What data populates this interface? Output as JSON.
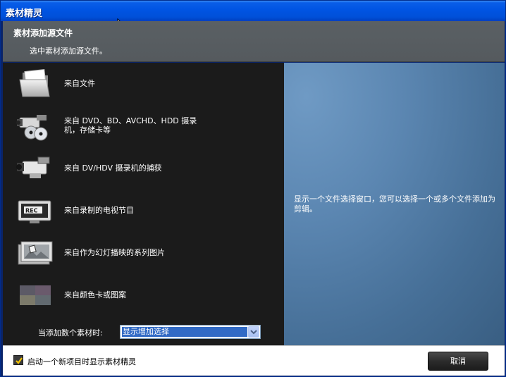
{
  "window": {
    "title": "素材精灵"
  },
  "header": {
    "title": "素材添加源文件",
    "subtitle": "选中素材添加源文件。"
  },
  "options": [
    {
      "icon": "folder-icon",
      "label": "来自文件"
    },
    {
      "icon": "camcorder-disc-icon",
      "label": "来自 DVD、BD、AVCHD、HDD 摄录机，存储卡等"
    },
    {
      "icon": "camcorder-icon",
      "label": "来自 DV/HDV 摄录机的捕获"
    },
    {
      "icon": "tv-rec-icon",
      "label": "来自录制的电视节目"
    },
    {
      "icon": "slideshow-icon",
      "label": "来自作为幻灯播映的系列图片"
    },
    {
      "icon": "color-card-icon",
      "label": "来自颜色卡或图案"
    }
  ],
  "add_multiple": {
    "label": "当添加数个素材时:",
    "selected": "显示增加选择"
  },
  "description": "显示一个文件选择窗口，您可以选择一个或多个文件添加为剪辑。",
  "footer": {
    "checkbox_label": "启动一个新项目时显示素材精灵",
    "checkbox_checked": true,
    "cancel_label": "取消"
  },
  "colors": {
    "titlebar": "#0054e3",
    "panel_dark": "#1b1b1b",
    "panel_blue": "#5b86b1",
    "accent_check": "#f2c200"
  }
}
